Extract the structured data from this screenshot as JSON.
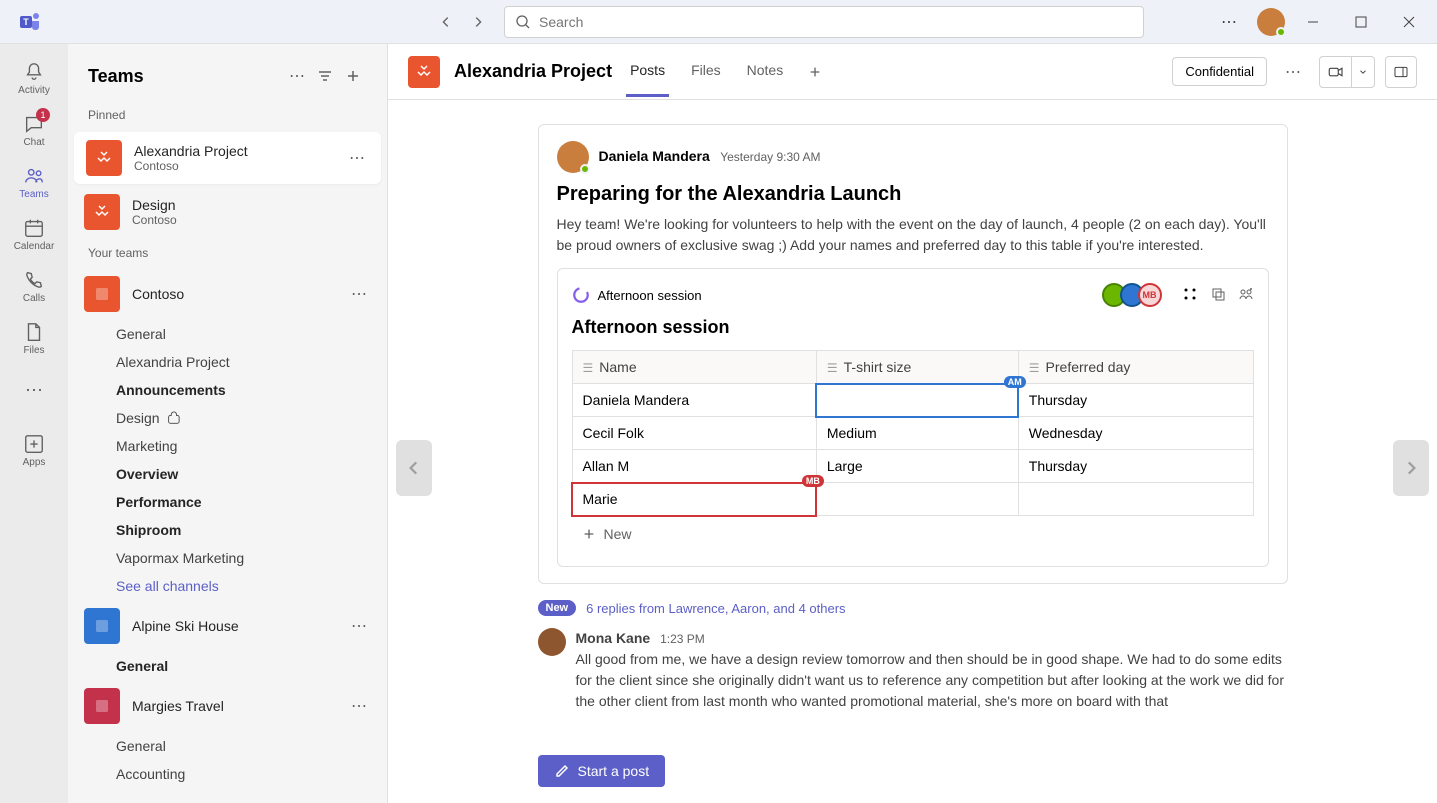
{
  "titlebar": {
    "search_placeholder": "Search"
  },
  "rail": {
    "activity": "Activity",
    "chat": "Chat",
    "chat_badge": "1",
    "teams": "Teams",
    "calendar": "Calendar",
    "calls": "Calls",
    "files": "Files",
    "apps": "Apps"
  },
  "sidebar": {
    "title": "Teams",
    "pinned_label": "Pinned",
    "your_teams_label": "Your teams",
    "pinned": [
      {
        "name": "Alexandria Project",
        "sub": "Contoso",
        "color": "#e8552f"
      },
      {
        "name": "Design",
        "sub": "Contoso",
        "color": "#e8552f"
      }
    ],
    "teams": [
      {
        "name": "Contoso",
        "color": "#e8552f",
        "channels": [
          {
            "label": "General",
            "bold": false
          },
          {
            "label": "Alexandria Project",
            "bold": false
          },
          {
            "label": "Announcements",
            "bold": true
          },
          {
            "label": "Design",
            "bold": false,
            "shared": true
          },
          {
            "label": "Marketing",
            "bold": false
          },
          {
            "label": "Overview",
            "bold": true
          },
          {
            "label": "Performance",
            "bold": true
          },
          {
            "label": "Shiproom",
            "bold": true
          },
          {
            "label": "Vapormax Marketing",
            "bold": false
          }
        ],
        "see_all": "See all channels"
      },
      {
        "name": "Alpine Ski House",
        "color": "#2f76d2",
        "channels": [
          {
            "label": "General",
            "bold": true
          }
        ]
      },
      {
        "name": "Margies Travel",
        "color": "#c4314b",
        "channels": [
          {
            "label": "General",
            "bold": false
          },
          {
            "label": "Accounting",
            "bold": false
          }
        ]
      }
    ]
  },
  "header": {
    "channel_name": "Alexandria Project",
    "tabs": [
      "Posts",
      "Files",
      "Notes"
    ],
    "active_tab": "Posts",
    "confidential": "Confidential",
    "team_color": "#e8552f"
  },
  "post": {
    "author": "Daniela Mandera",
    "time": "Yesterday 9:30 AM",
    "title": "Preparing for the Alexandria Launch",
    "body": "Hey team! We're looking for volunteers to help with the event on the day of launch, 4 people (2 on each day). You'll be proud owners of exclusive swag ;) Add your names and preferred day to this table if you're interested."
  },
  "loop": {
    "breadcrumb": "Afternoon session",
    "title": "Afternoon session",
    "presence": [
      {
        "initials": "",
        "bg": "#6bb700",
        "border": "#498205"
      },
      {
        "initials": "",
        "bg": "#2f76d2",
        "border": "#0f548c"
      },
      {
        "initials": "MB",
        "bg": "#f7d7d7",
        "border": "#d13438",
        "text": "#d13438"
      }
    ],
    "columns": [
      "Name",
      "T-shirt size",
      "Preferred day"
    ],
    "rows": [
      {
        "name": "Daniela Mandera",
        "size": "",
        "day": "Thursday",
        "size_sel": "blue",
        "size_tag": "AM",
        "size_tag_bg": "#2f76d2"
      },
      {
        "name": "Cecil Folk",
        "size": "Medium",
        "day": "Wednesday"
      },
      {
        "name": "Allan M",
        "size": "Large",
        "day": "Thursday"
      },
      {
        "name": "Marie",
        "size": "",
        "day": "",
        "name_sel": "red",
        "name_tag": "MB",
        "name_tag_bg": "#d13438"
      }
    ],
    "new_row": "New"
  },
  "replies": {
    "new_label": "New",
    "summary": "6 replies from Lawrence, Aaron, and 4 others",
    "reply": {
      "author": "Mona Kane",
      "time": "1:23 PM",
      "text": "All good from me, we have a design review tomorrow and then should be in good shape. We had to do some edits for the client since she originally didn't want us to reference any competition but after looking at the work we did for the other client from last month who wanted promotional material, she's more on board with that"
    }
  },
  "compose": {
    "start_post": "Start a post"
  }
}
